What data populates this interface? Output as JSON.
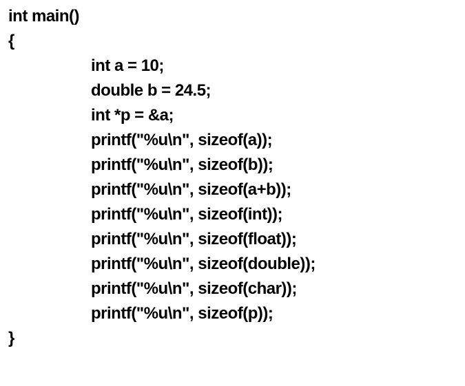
{
  "code": {
    "lines": [
      {
        "indent": 0,
        "text": "int main()"
      },
      {
        "indent": 0,
        "text": "{"
      },
      {
        "indent": 1,
        "text": "int a = 10;"
      },
      {
        "indent": 1,
        "text": "double b = 24.5;"
      },
      {
        "indent": 1,
        "text": "int *p = &a;"
      },
      {
        "indent": 1,
        "text": "printf(\"%u\\n\", sizeof(a));"
      },
      {
        "indent": 1,
        "text": "printf(\"%u\\n\", sizeof(b));"
      },
      {
        "indent": 1,
        "text": "printf(\"%u\\n\", sizeof(a+b));"
      },
      {
        "indent": 1,
        "text": "printf(\"%u\\n\", sizeof(int));"
      },
      {
        "indent": 1,
        "text": "printf(\"%u\\n\", sizeof(float));"
      },
      {
        "indent": 1,
        "text": "printf(\"%u\\n\", sizeof(double));"
      },
      {
        "indent": 1,
        "text": "printf(\"%u\\n\", sizeof(char));"
      },
      {
        "indent": 1,
        "text": "printf(\"%u\\n\", sizeof(p));"
      },
      {
        "indent": 0,
        "text": "}"
      }
    ]
  }
}
